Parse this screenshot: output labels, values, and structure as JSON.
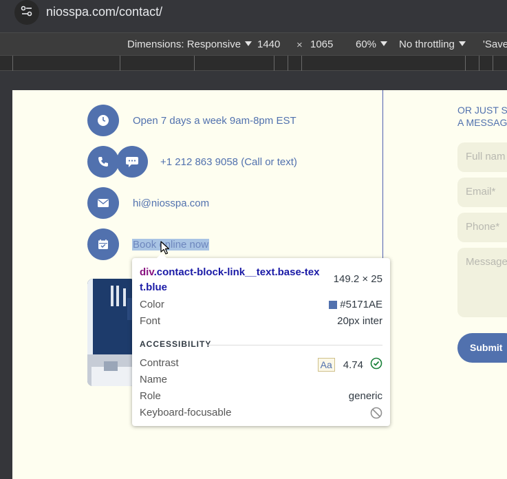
{
  "browser": {
    "url": "niosspa.com/contact/"
  },
  "device_toolbar": {
    "dimensions_label": "Dimensions: Responsive",
    "width": "1440",
    "times": "×",
    "height": "1065",
    "zoom": "60%",
    "throttling": "No throttling",
    "save_label": "'Save"
  },
  "contact": {
    "hours": "Open 7 days a week 9am-8pm EST",
    "phone": "+1 212 863 9058 (Call or text)",
    "email": "hi@niosspa.com",
    "book": "Book online now"
  },
  "form": {
    "heading_line1": "OR JUST S",
    "heading_line2": "A MESSAG",
    "full_name_placeholder": "Full nam",
    "email_placeholder": "Email*",
    "phone_placeholder": "Phone*",
    "message_placeholder": "Message",
    "submit_label": "Submit"
  },
  "tooltip": {
    "tag": "div",
    "class_name": ".contact-block-link__text.base-text.blue",
    "size": "149.2 × 25",
    "color_label": "Color",
    "color_value": "#5171AE",
    "font_label": "Font",
    "font_value": "20px inter",
    "section_label": "ACCESSIBILITY",
    "contrast_label": "Contrast",
    "contrast_aa": "Aa",
    "contrast_value": "4.74",
    "name_label": "Name",
    "role_label": "Role",
    "role_value": "generic",
    "keyboard_label": "Keyboard-focusable"
  },
  "colors": {
    "accent": "#5171AE",
    "page_background": "#FEFEF0"
  },
  "icons": [
    "site-info-icon",
    "clock-icon",
    "phone-icon",
    "chat-icon",
    "mail-icon",
    "calendar-icon",
    "cursor-icon",
    "check-circle-icon",
    "not-allowed-icon"
  ]
}
